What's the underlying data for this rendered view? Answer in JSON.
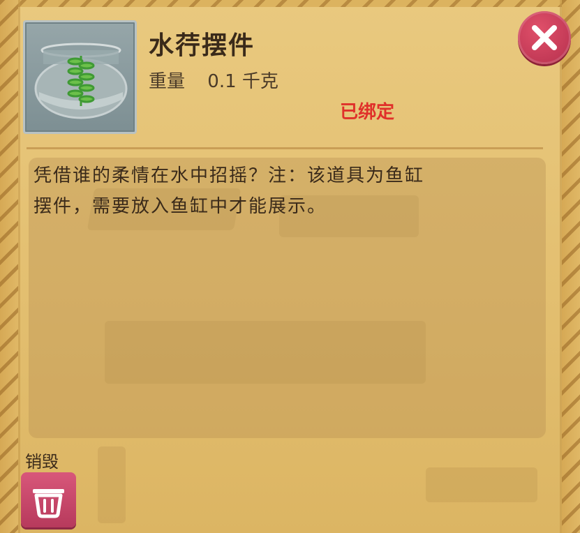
{
  "item": {
    "name": "水荇摆件",
    "weight_label": "重量",
    "weight_value": "0.1 千克",
    "bound_status": "已绑定",
    "icon": "fish-tank-plant-icon"
  },
  "description": {
    "line1": "凭借谁的柔情在水中招摇？注：该道具为鱼缸",
    "line2": "摆件，需要放入鱼缸中才能展示。"
  },
  "actions": {
    "destroy_label": "销毁",
    "destroy_icon": "trash-icon",
    "close_icon": "close-icon"
  },
  "colors": {
    "bound": "#e0302a",
    "close_button": "#c23a57",
    "destroy_button": "#c8476b"
  }
}
